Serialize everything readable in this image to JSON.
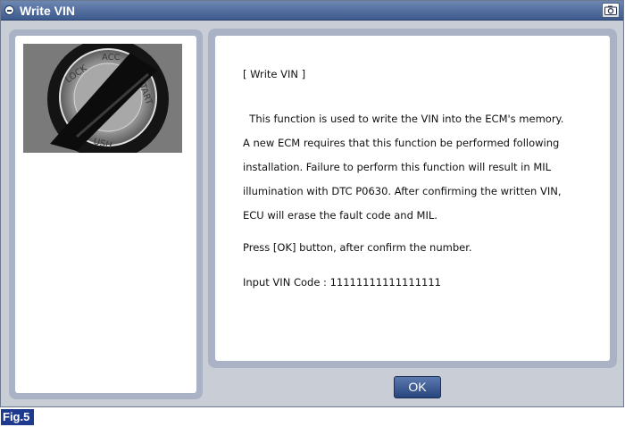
{
  "window": {
    "title": "Write VIN",
    "title_icon": "window-menu-icon",
    "capture_icon": "camera-icon"
  },
  "image": {
    "description_icon": "ignition-key-cylinder",
    "lock_labels": [
      "LOCK",
      "ACC",
      "START",
      "ON"
    ]
  },
  "message": {
    "heading": "[ Write VIN ]",
    "lines": [
      "  This function is used to write the VIN into the ECM's memory.",
      "A new ECM requires that this function be performed following",
      "installation.  Failure to perform this function will result in MIL",
      "illumination with DTC P0630.  After confirming the written VIN,",
      "ECU will erase the fault code and MIL."
    ],
    "instruction": "Press [OK] button, after confirm the number.",
    "vin_prompt": "Input VIN Code : 11111111111111111"
  },
  "buttons": {
    "ok_label": "OK"
  },
  "figure": {
    "label": "Fig.5"
  },
  "colors": {
    "titlebar": "#3d5a8e",
    "panel_frame": "#aab3c6",
    "ok_button": "#27457d",
    "fig_label": "#1e3a8e"
  }
}
